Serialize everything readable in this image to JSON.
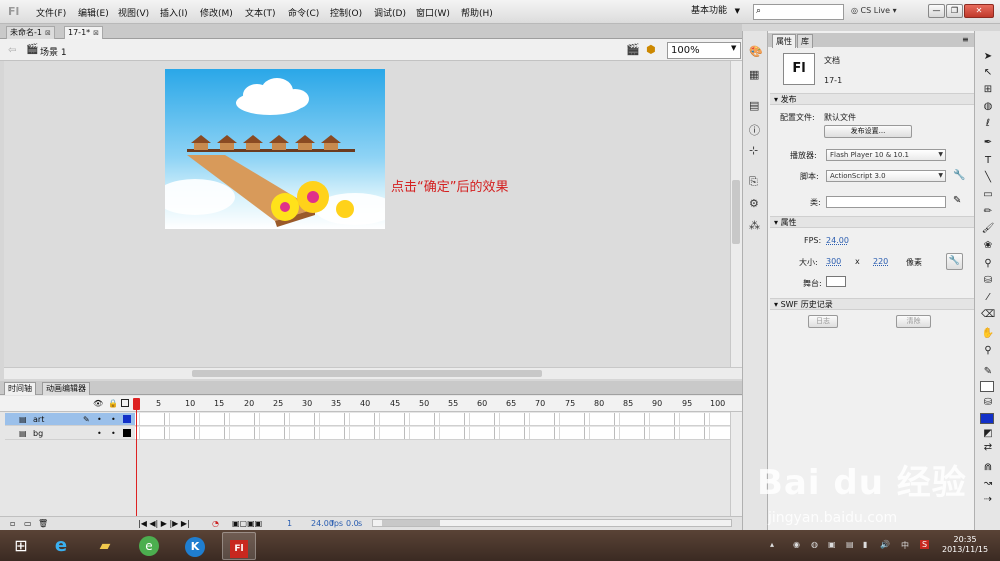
{
  "app": {
    "logo": "Fl"
  },
  "menu": [
    "文件(F)",
    "编辑(E)",
    "视图(V)",
    "插入(I)",
    "修改(M)",
    "文本(T)",
    "命令(C)",
    "控制(O)",
    "调试(D)",
    "窗口(W)",
    "帮助(H)"
  ],
  "workspace": "基本功能",
  "cs_live": "CS Live",
  "doc_tabs": [
    "未命名-1",
    "17-1*"
  ],
  "scene": "场景 1",
  "zoom": "100%",
  "annotation": "点击“确定”后的效果",
  "timeline_tabs": [
    "时间轴",
    "动画编辑器"
  ],
  "frame_numbers": [
    "5",
    "10",
    "15",
    "20",
    "25",
    "30",
    "35",
    "40",
    "45",
    "50",
    "55",
    "60",
    "65",
    "70",
    "75",
    "80",
    "85",
    "90",
    "95",
    "100"
  ],
  "layers": [
    {
      "name": "art"
    },
    {
      "name": "bg"
    }
  ],
  "timeline_status": {
    "frame": "1",
    "fps": "24.00",
    "fps_unit": "fps",
    "time": "0.0",
    "time_unit": "s"
  },
  "props": {
    "tabs": [
      "属性",
      "库"
    ],
    "doc_icon": "Fl",
    "doc_type": "文档",
    "doc_name": "17-1",
    "publish": {
      "header": "发布",
      "profile_label": "配置文件:",
      "profile_value": "默认文件",
      "settings_button": "发布设置...",
      "player_label": "播放器:",
      "player_value": "Flash Player 10 & 10.1",
      "script_label": "脚本:",
      "script_value": "ActionScript 3.0",
      "class_label": "类:"
    },
    "attributes": {
      "header": "属性",
      "fps_label": "FPS:",
      "fps_value": "24.00",
      "size_label": "大小:",
      "width": "300",
      "x": "x",
      "height": "220",
      "unit": "像素",
      "stage_label": "舞台:"
    },
    "swf": {
      "header": "SWF 历史记录",
      "log_button": "日志",
      "clear_button": "清除"
    }
  },
  "watermark": {
    "text": "Bai du 经验",
    "url": "jingyan.baidu.com"
  },
  "taskbar": {
    "time": "20:35",
    "date": "2013/11/15",
    "ime": "中"
  },
  "colors": {
    "annotation": "#d42020",
    "stage_sky": "#2aa7e8",
    "taskbar": "#4a3529",
    "selected_layer": "#9bc0ea"
  }
}
